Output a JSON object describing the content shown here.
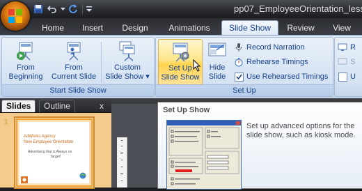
{
  "window": {
    "title": "pp07_EmployeeOrientation_less"
  },
  "colors": {
    "accent_orange": "#e07f12",
    "ribbon_blue": "#15428b",
    "slide_border": "#d38a2c",
    "hover_gold": "#ffd34e"
  },
  "quick_access": {
    "icons": [
      "save-icon",
      "undo-icon",
      "redo-icon",
      "customize-qat-icon"
    ]
  },
  "tabs": [
    {
      "label": "Home"
    },
    {
      "label": "Insert"
    },
    {
      "label": "Design"
    },
    {
      "label": "Animations"
    },
    {
      "label": "Slide Show",
      "active": true
    },
    {
      "label": "Review"
    },
    {
      "label": "View"
    }
  ],
  "ribbon": {
    "start_group": {
      "label": "Start Slide Show",
      "from_beginning": {
        "line1": "From",
        "line2": "Beginning"
      },
      "from_current": {
        "line1": "From",
        "line2": "Current Slide"
      },
      "custom": {
        "line1": "Custom",
        "line2": "Slide Show",
        "arrow": "▾"
      }
    },
    "setup_group": {
      "label": "Set Up",
      "setup_show": {
        "line1": "Set Up",
        "line2": "Slide Show"
      },
      "hide_slide": {
        "line1": "Hide",
        "line2": "Slide"
      },
      "record_narration": "Record Narration",
      "rehearse_timings": "Rehearse Timings",
      "use_rehearsed": "Use Rehearsed Timings",
      "use_rehearsed_checked": true
    },
    "monitors_group": {
      "item1": "R",
      "item2": "S",
      "item3": "U"
    }
  },
  "slide_pane": {
    "tabs": [
      {
        "label": "Slides",
        "active": true
      },
      {
        "label": "Outline"
      }
    ],
    "close": "x",
    "slide_number": "1",
    "thumbnail": {
      "title_line1": "AdWorks Agency",
      "title_line2": "New Employee Orientation",
      "subtitle_line1": "Advertising that is Always on",
      "subtitle_line2": "Target!"
    }
  },
  "tooltip": {
    "title": "Set Up Show",
    "body": "Set up advanced options for the slide show, such as kiosk mode."
  }
}
